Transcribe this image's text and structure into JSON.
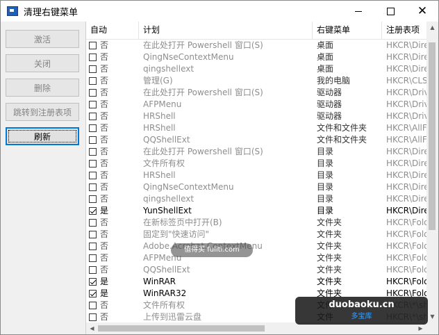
{
  "window": {
    "title": "清理右键菜单",
    "icon": "app-icon",
    "controls": {
      "minimize": "minimize-icon",
      "maximize": "maximize-icon",
      "close": "close-icon"
    }
  },
  "buttons": [
    {
      "label": "激活",
      "enabled": false
    },
    {
      "label": "关闭",
      "enabled": false
    },
    {
      "label": "删除",
      "enabled": false
    },
    {
      "label": "跳转到注册表项",
      "enabled": false
    },
    {
      "label": "刷新",
      "enabled": true,
      "focused": true
    }
  ],
  "columns": [
    "自动",
    "计划",
    "右键菜单",
    "注册表项"
  ],
  "rows": [
    {
      "checked": false,
      "auto": "否",
      "plan": "在此处打开 Powershell 窗口(S)",
      "menu": "桌面",
      "reg": "HKCR\\Directo"
    },
    {
      "checked": false,
      "auto": "否",
      "plan": "QingNseContextMenu",
      "menu": "桌面",
      "reg": "HKCR\\Directo"
    },
    {
      "checked": false,
      "auto": "否",
      "plan": "qingshellext",
      "menu": "桌面",
      "reg": "HKCR\\Directo"
    },
    {
      "checked": false,
      "auto": "否",
      "plan": "管理(G)",
      "menu": "我的电脑",
      "reg": "HKCR\\CLSID"
    },
    {
      "checked": false,
      "auto": "否",
      "plan": "在此处打开 Powershell 窗口(S)",
      "menu": "驱动器",
      "reg": "HKCR\\Drive\\"
    },
    {
      "checked": false,
      "auto": "否",
      "plan": "AFPMenu",
      "menu": "驱动器",
      "reg": "HKCR\\Drive\\"
    },
    {
      "checked": false,
      "auto": "否",
      "plan": "HRShell",
      "menu": "驱动器",
      "reg": "HKCR\\Drive\\"
    },
    {
      "checked": false,
      "auto": "否",
      "plan": "HRShell",
      "menu": "文件和文件夹",
      "reg": "HKCR\\AllFiles"
    },
    {
      "checked": false,
      "auto": "否",
      "plan": "QQShellExt",
      "menu": "文件和文件夹",
      "reg": "HKCR\\AllFiles"
    },
    {
      "checked": false,
      "auto": "否",
      "plan": "在此处打开 Powershell 窗口(S)",
      "menu": "目录",
      "reg": "HKCR\\Directo"
    },
    {
      "checked": false,
      "auto": "否",
      "plan": "文件所有权",
      "menu": "目录",
      "reg": "HKCR\\Directo"
    },
    {
      "checked": false,
      "auto": "否",
      "plan": "HRShell",
      "menu": "目录",
      "reg": "HKCR\\Directo"
    },
    {
      "checked": false,
      "auto": "否",
      "plan": "QingNseContextMenu",
      "menu": "目录",
      "reg": "HKCR\\Directo"
    },
    {
      "checked": false,
      "auto": "否",
      "plan": "qingshellext",
      "menu": "目录",
      "reg": "HKCR\\Directo"
    },
    {
      "checked": true,
      "auto": "是",
      "plan": "YunShellExt",
      "menu": "目录",
      "reg": "HKCR\\Directo"
    },
    {
      "checked": false,
      "auto": "否",
      "plan": "在新标签页中打开(B)",
      "menu": "文件夹",
      "reg": "HKCR\\Folder"
    },
    {
      "checked": false,
      "auto": "否",
      "plan": "固定到\"快速访问\"",
      "menu": "文件夹",
      "reg": "HKCR\\Folder"
    },
    {
      "checked": false,
      "auto": "否",
      "plan": "Adobe.Acrobat.ContextMenu",
      "menu": "文件夹",
      "reg": "HKCR\\Folder"
    },
    {
      "checked": false,
      "auto": "否",
      "plan": "AFPMenu",
      "menu": "文件夹",
      "reg": "HKCR\\Folder"
    },
    {
      "checked": false,
      "auto": "否",
      "plan": "QQShellExt",
      "menu": "文件夹",
      "reg": "HKCR\\Folder"
    },
    {
      "checked": true,
      "auto": "是",
      "plan": "WinRAR",
      "menu": "文件夹",
      "reg": "HKCR\\Folder"
    },
    {
      "checked": true,
      "auto": "是",
      "plan": "WinRAR32",
      "menu": "文件夹",
      "reg": "HKCR\\Folder"
    },
    {
      "checked": false,
      "auto": "否",
      "plan": "文件所有权",
      "menu": "文件",
      "reg": "HKCR\\*\\she"
    },
    {
      "checked": false,
      "auto": "否",
      "plan": "上传到迅雷云盘",
      "menu": "文件",
      "reg": "HKCR\\*\\she"
    }
  ],
  "scrollbar_icons": {
    "up": "scroll-up-icon",
    "down": "scroll-down-icon",
    "left": "scroll-left-icon",
    "right": "scroll-right-icon"
  },
  "watermarks": {
    "center": "值得买 fuliti.com",
    "badge_domain": "duobaoku.cn",
    "badge_name": "多宝库"
  }
}
